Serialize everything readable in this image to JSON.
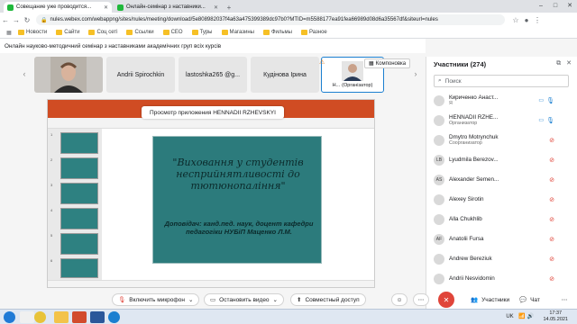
{
  "browser": {
    "tabs": [
      {
        "title": "Совещание уже проводится...",
        "icon_color": "#1fb83b",
        "active": true
      },
      {
        "title": "Онлайн-семінар з наставники...",
        "icon_color": "#1fb83b",
        "active": false
      }
    ],
    "new_tab": "+",
    "url": "nules.webex.com/webappng/sites/nules/meeting/download/5e808982037f4a63a475399389dc97b0?MTID=m5588177ea91fea66989d08d6a35567df&siteurl=nules",
    "bookmarks": [
      "Новости",
      "Сайти",
      "Соц сеті",
      "Ссылки",
      "CEO",
      "Туры",
      "Магазины",
      "Фильмы",
      "Разное"
    ]
  },
  "meeting": {
    "title": "Онлайн науково-методичний семінар з наставниками академічних груп всіх курсів",
    "thumbnails": [
      {
        "label": "Andrii Spirochkin"
      },
      {
        "label": "lastoshka265 @g..."
      },
      {
        "label": "Кудінова Ірина"
      },
      {
        "label": "H...",
        "role": "(Організатор)"
      }
    ],
    "layout_button": "Компоновка",
    "share_banner": "Просмотр приложения HENNADII RZHEVSKYI"
  },
  "slide": {
    "title": "\"Виховання у студентів несприйнятливості до тютюнопаління\"",
    "speaker": "Доповідач: канд.пед. наук, доцент кафедри педагогіки НУБіП Маценко Л.М.",
    "slide_count": 6
  },
  "participants": {
    "header": "Участники (274)",
    "search_placeholder": "Поиск",
    "list": [
      {
        "name": "Кириченко Анаст...",
        "role": "Я",
        "initials": "",
        "mic": "on",
        "cam": true
      },
      {
        "name": "HENNADII RZHE...",
        "role": "Организатор",
        "initials": "",
        "mic": "on",
        "cam": true
      },
      {
        "name": "Dmytro Motrynchuk",
        "role": "Соорганизатор",
        "initials": "",
        "mic": "muted",
        "cam": false
      },
      {
        "name": "Lyudmila Berezov...",
        "role": "",
        "initials": "LB",
        "mic": "muted",
        "cam": false
      },
      {
        "name": "Alexander Semen...",
        "role": "",
        "initials": "AS",
        "mic": "muted",
        "cam": false
      },
      {
        "name": "Alexey Sirotin",
        "role": "",
        "initials": "",
        "mic": "muted",
        "cam": false
      },
      {
        "name": "Alla Chukhlib",
        "role": "",
        "initials": "",
        "mic": "muted",
        "cam": false
      },
      {
        "name": "Anatolii Fursa",
        "role": "",
        "initials": "AF",
        "mic": "muted",
        "cam": false
      },
      {
        "name": "Andrew Bereziuk",
        "role": "",
        "initials": "",
        "mic": "muted",
        "cam": false
      },
      {
        "name": "Andrii Nesvidomin",
        "role": "",
        "initials": "",
        "mic": "muted",
        "cam": false
      }
    ]
  },
  "controls": {
    "mute": "Включить микрофон",
    "video": "Остановить видео",
    "share": "Совместный доступ",
    "participants": "Участники",
    "chat": "Чат"
  },
  "taskbar": {
    "lang": "UK",
    "time": "17:37",
    "date": "14.05.2021"
  }
}
